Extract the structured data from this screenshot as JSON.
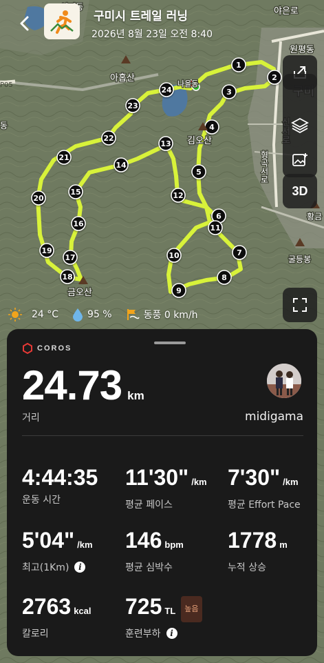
{
  "header": {
    "title": "구미시 트레일 러닝",
    "datetime": "2026년 8월 23일 오전 8:40"
  },
  "map": {
    "route_color": "#d8f23a",
    "place_labels": [
      {
        "id": "ayongsan",
        "text": "아홉산"
      },
      {
        "id": "naeul",
        "text": "나을동"
      },
      {
        "id": "gimosan",
        "text": "김오산"
      },
      {
        "id": "geumosan",
        "text": "금오산"
      },
      {
        "id": "gumi",
        "text": "구미"
      },
      {
        "id": "wonpyeong",
        "text": "원평동"
      },
      {
        "id": "yaeunro",
        "text": "야은로"
      },
      {
        "id": "sinseoro",
        "text": "신서로"
      },
      {
        "id": "hyeongoseoro",
        "text": "형곡서로"
      },
      {
        "id": "hwanggeum",
        "text": "황금"
      },
      {
        "id": "gueungbong",
        "text": "굴등봉"
      },
      {
        "id": "seongdong",
        "text": "선기동"
      },
      {
        "id": "dong",
        "text": "동"
      },
      {
        "id": "p05",
        "text": "P05"
      }
    ],
    "waypoints": [
      "1",
      "2",
      "3",
      "4",
      "5",
      "6",
      "7",
      "8",
      "9",
      "10",
      "11",
      "12",
      "13",
      "14",
      "15",
      "16",
      "17",
      "18",
      "19",
      "20",
      "21",
      "22",
      "23",
      "24"
    ],
    "buttons": {
      "share": "share-icon",
      "layers": "layers-icon",
      "add_photo": "add-photo-icon",
      "three_d": "3D",
      "fullscreen": "fullscreen-icon"
    }
  },
  "weather": {
    "temperature": "24 °C",
    "humidity": "95 %",
    "wind": "동풍 0 km/h"
  },
  "panel": {
    "brand": "COROS",
    "distance": {
      "value": "24.73",
      "unit": "km",
      "label": "거리"
    },
    "username": "midigama",
    "metrics": [
      {
        "value": "4:44:35",
        "unit": "",
        "label": "운동 시간"
      },
      {
        "value": "11'30\"",
        "unit": "/km",
        "label": "평균 페이스"
      },
      {
        "value": "7'30\"",
        "unit": "/km",
        "label": "평균 Effort Pace"
      },
      {
        "value": "5'04\"",
        "unit": "/km",
        "label": "최고(1Km)"
      },
      {
        "value": "146",
        "unit": "bpm",
        "label": "평균 심박수"
      },
      {
        "value": "1778",
        "unit": "m",
        "label": "누적 상승"
      },
      {
        "value": "2763",
        "unit": "kcal",
        "label": "칼로리"
      },
      {
        "value": "725",
        "unit": "TL",
        "label": "훈련부하",
        "badge": "높음"
      }
    ]
  }
}
